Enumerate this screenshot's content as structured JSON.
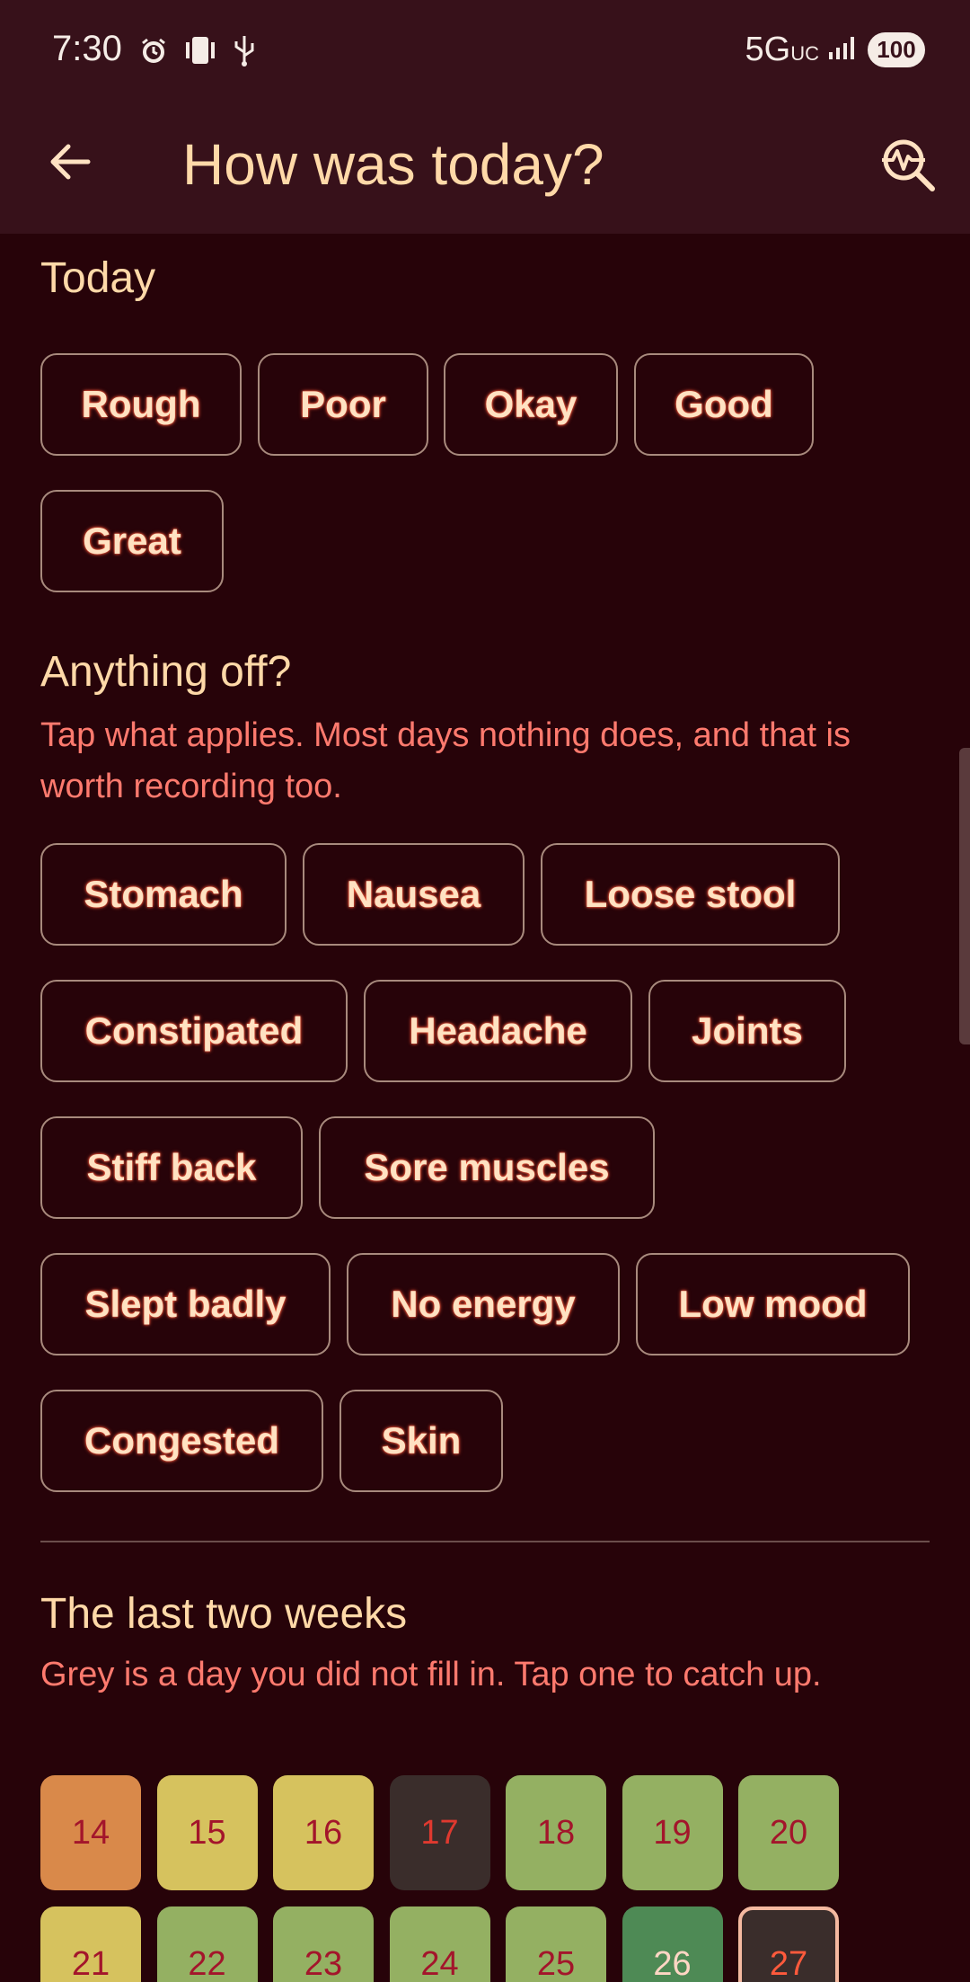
{
  "status_bar": {
    "time": "7:30",
    "network": "5G",
    "network_suffix": "UC",
    "battery": "100"
  },
  "app_bar": {
    "title": "How was today?",
    "back_icon": "arrow-left-icon",
    "insights_icon": "pulse-search-icon"
  },
  "today": {
    "heading": "Today",
    "options": [
      "Rough",
      "Poor",
      "Okay",
      "Good",
      "Great"
    ]
  },
  "symptoms": {
    "heading": "Anything off?",
    "subtitle": "Tap what applies. Most days nothing does, and that is worth recording too.",
    "options": [
      "Stomach",
      "Nausea",
      "Loose stool",
      "Constipated",
      "Headache",
      "Joints",
      "Stiff back",
      "Sore muscles",
      "Slept badly",
      "No energy",
      "Low mood",
      "Congested",
      "Skin"
    ]
  },
  "history": {
    "heading": "The last two weeks",
    "subtitle": "Grey is a day you did not fill in. Tap one to catch up.",
    "days": [
      {
        "label": "14",
        "color": "#d9894a"
      },
      {
        "label": "15",
        "color": "#d6c25e"
      },
      {
        "label": "16",
        "color": "#d6c25e"
      },
      {
        "label": "17",
        "color": "#3a2d2b"
      },
      {
        "label": "18",
        "color": "#94b062"
      },
      {
        "label": "19",
        "color": "#94b062"
      },
      {
        "label": "20",
        "color": "#94b062"
      },
      {
        "label": "21",
        "color": "#d6c25e"
      },
      {
        "label": "22",
        "color": "#94b062"
      },
      {
        "label": "23",
        "color": "#94b062"
      },
      {
        "label": "24",
        "color": "#94b062"
      },
      {
        "label": "25",
        "color": "#94b062"
      },
      {
        "label": "26",
        "color": "#4e8a55"
      },
      {
        "label": "27",
        "color": "#3a2d2b"
      }
    ],
    "today_label": "27"
  }
}
